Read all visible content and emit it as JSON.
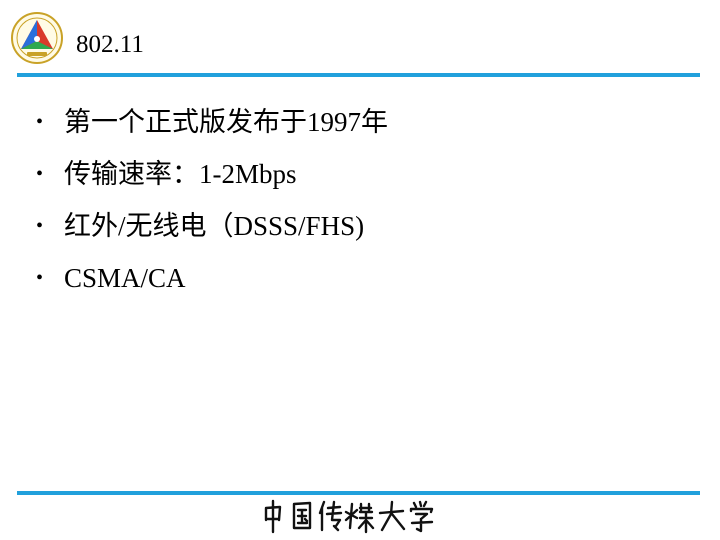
{
  "header": {
    "title": "802.11",
    "logo_icon": "university-emblem-icon"
  },
  "bullets": [
    {
      "text": "第一个正式版发布于1997年"
    },
    {
      "text": "传输速率：1-2Mbps"
    },
    {
      "text": "红外/无线电（DSSS/FHS)"
    },
    {
      "text": "CSMA/CA"
    }
  ],
  "footer": {
    "calligraphy_text": "中国传媒大学"
  },
  "colors": {
    "rule": "#21a0dc",
    "text": "#000000",
    "background": "#ffffff"
  },
  "bullet_glyph": "•"
}
